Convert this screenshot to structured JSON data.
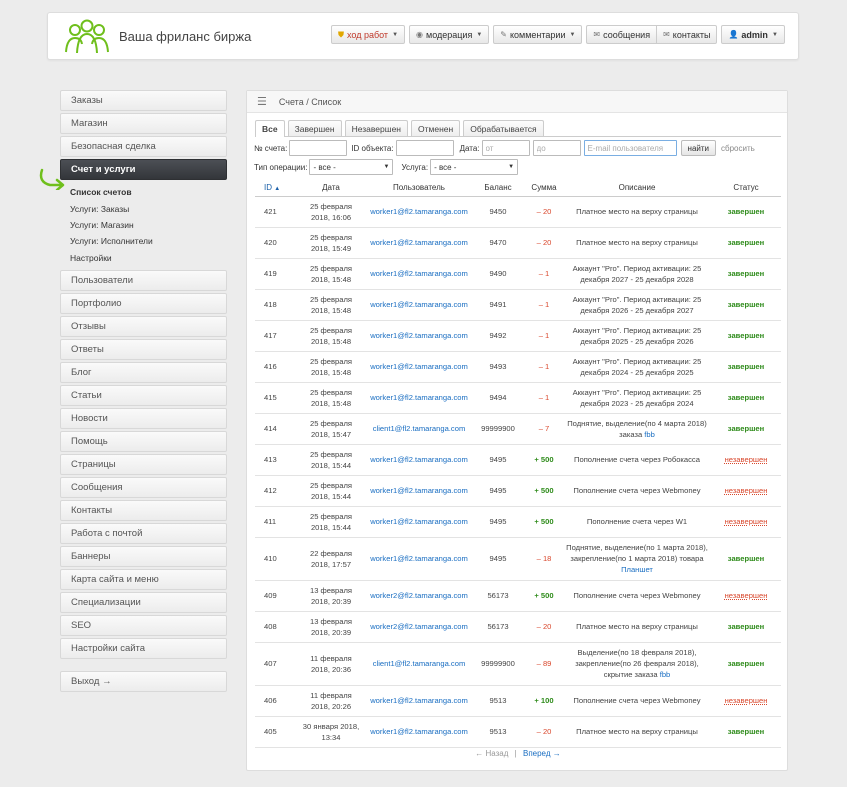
{
  "header": {
    "site_title": "Ваша фриланс биржа",
    "nav": {
      "worker": "ход работ",
      "moderation": "модерация",
      "comments": "комментарии",
      "messages": "сообщения",
      "contacts": "контакты",
      "user": "admin"
    }
  },
  "sidebar": {
    "items_top": [
      {
        "key": "orders",
        "label": "Заказы"
      },
      {
        "key": "shop",
        "label": "Магазин"
      },
      {
        "key": "safe-deal",
        "label": "Безопасная сделка"
      },
      {
        "key": "bills",
        "label": "Счет и услуги"
      }
    ],
    "sub_items": [
      {
        "key": "bills-list",
        "label": "Список счетов"
      },
      {
        "key": "services-orders",
        "label": "Услуги: Заказы"
      },
      {
        "key": "services-shop",
        "label": "Услуги: Магазин"
      },
      {
        "key": "services-performers",
        "label": "Услуги: Исполнители"
      },
      {
        "key": "settings",
        "label": "Настройки"
      }
    ],
    "items_bottom": [
      {
        "key": "users",
        "label": "Пользователи"
      },
      {
        "key": "portfolio",
        "label": "Портфолио"
      },
      {
        "key": "reviews",
        "label": "Отзывы"
      },
      {
        "key": "answers",
        "label": "Ответы"
      },
      {
        "key": "blog",
        "label": "Блог"
      },
      {
        "key": "articles",
        "label": "Статьи"
      },
      {
        "key": "news",
        "label": "Новости"
      },
      {
        "key": "help",
        "label": "Помощь"
      },
      {
        "key": "pages",
        "label": "Страницы"
      },
      {
        "key": "messages",
        "label": "Сообщения"
      },
      {
        "key": "contacts",
        "label": "Контакты"
      },
      {
        "key": "mail",
        "label": "Работа с почтой"
      },
      {
        "key": "banners",
        "label": "Баннеры"
      },
      {
        "key": "sitemap",
        "label": "Карта сайта и меню"
      },
      {
        "key": "specs",
        "label": "Специализации"
      },
      {
        "key": "seo",
        "label": "SEO"
      },
      {
        "key": "site-settings",
        "label": "Настройки сайта"
      }
    ],
    "logout": "Выход →"
  },
  "main": {
    "breadcrumb": "Счета / Список",
    "tabs": [
      "Все",
      "Завершен",
      "Незавершен",
      "Отменен",
      "Обрабатывается"
    ],
    "filters": {
      "bill_no_label": "№ счета:",
      "object_id_label": "ID объекта:",
      "date_label": "Дата:",
      "date_from_placeholder": "от",
      "date_to_placeholder": "до",
      "email_placeholder": "E-mail пользователя",
      "find_label": "найти",
      "reset_label": "сбросить",
      "op_type_label": "Тип операции:",
      "op_type_value": "- все -",
      "service_label": "Услуга:",
      "service_value": "- все -"
    },
    "columns": [
      "ID",
      "Дата",
      "Пользователь",
      "Баланс",
      "Сумма",
      "Описание",
      "Статус"
    ],
    "rows": [
      {
        "id": "421",
        "date1": "25 февраля",
        "date2": "2018, 16:06",
        "user": "worker1@fl2.tamaranga.com",
        "balance": "9450",
        "sum": "– 20",
        "sign": "neg",
        "desc1": "Платное место на верху страницы",
        "desc2": "",
        "desc_link": "",
        "status": "завершен",
        "status_type": "done"
      },
      {
        "id": "420",
        "date1": "25 февраля",
        "date2": "2018, 15:49",
        "user": "worker1@fl2.tamaranga.com",
        "balance": "9470",
        "sum": "– 20",
        "sign": "neg",
        "desc1": "Платное место на верху страницы",
        "desc2": "",
        "desc_link": "",
        "status": "завершен",
        "status_type": "done"
      },
      {
        "id": "419",
        "date1": "25 февраля",
        "date2": "2018, 15:48",
        "user": "worker1@fl2.tamaranga.com",
        "balance": "9490",
        "sum": "– 1",
        "sign": "neg",
        "desc1": "Аккаунт \"Pro\". Период активации: 25",
        "desc2": "декабря 2027 - 25 декабря 2028",
        "desc_link": "",
        "status": "завершен",
        "status_type": "done"
      },
      {
        "id": "418",
        "date1": "25 февраля",
        "date2": "2018, 15:48",
        "user": "worker1@fl2.tamaranga.com",
        "balance": "9491",
        "sum": "– 1",
        "sign": "neg",
        "desc1": "Аккаунт \"Pro\". Период активации: 25",
        "desc2": "декабря 2026 - 25 декабря 2027",
        "desc_link": "",
        "status": "завершен",
        "status_type": "done"
      },
      {
        "id": "417",
        "date1": "25 февраля",
        "date2": "2018, 15:48",
        "user": "worker1@fl2.tamaranga.com",
        "balance": "9492",
        "sum": "– 1",
        "sign": "neg",
        "desc1": "Аккаунт \"Pro\". Период активации: 25",
        "desc2": "декабря 2025 - 25 декабря 2026",
        "desc_link": "",
        "status": "завершен",
        "status_type": "done"
      },
      {
        "id": "416",
        "date1": "25 февраля",
        "date2": "2018, 15:48",
        "user": "worker1@fl2.tamaranga.com",
        "balance": "9493",
        "sum": "– 1",
        "sign": "neg",
        "desc1": "Аккаунт \"Pro\". Период активации: 25",
        "desc2": "декабря 2024 - 25 декабря 2025",
        "desc_link": "",
        "status": "завершен",
        "status_type": "done"
      },
      {
        "id": "415",
        "date1": "25 февраля",
        "date2": "2018, 15:48",
        "user": "worker1@fl2.tamaranga.com",
        "balance": "9494",
        "sum": "– 1",
        "sign": "neg",
        "desc1": "Аккаунт \"Pro\". Период активации: 25",
        "desc2": "декабря 2023 - 25 декабря 2024",
        "desc_link": "",
        "status": "завершен",
        "status_type": "done"
      },
      {
        "id": "414",
        "date1": "25 февраля",
        "date2": "2018, 15:47",
        "user": "client1@fl2.tamaranga.com",
        "balance": "99999900",
        "sum": "– 7",
        "sign": "neg",
        "desc1": "Поднятие, выделение(по 4 марта 2018)",
        "desc2": "заказа",
        "desc_link": "fbb",
        "status": "завершен",
        "status_type": "done"
      },
      {
        "id": "413",
        "date1": "25 февраля",
        "date2": "2018, 15:44",
        "user": "worker1@fl2.tamaranga.com",
        "balance": "9495",
        "sum": "+ 500",
        "sign": "pos",
        "desc1": "Пополнение счета через Робокасса",
        "desc2": "",
        "desc_link": "",
        "status": "незавершен",
        "status_type": "undone"
      },
      {
        "id": "412",
        "date1": "25 февраля",
        "date2": "2018, 15:44",
        "user": "worker1@fl2.tamaranga.com",
        "balance": "9495",
        "sum": "+ 500",
        "sign": "pos",
        "desc1": "Пополнение счета через Webmoney",
        "desc2": "",
        "desc_link": "",
        "status": "незавершен",
        "status_type": "undone"
      },
      {
        "id": "411",
        "date1": "25 февраля",
        "date2": "2018, 15:44",
        "user": "worker1@fl2.tamaranga.com",
        "balance": "9495",
        "sum": "+ 500",
        "sign": "pos",
        "desc1": "Пополнение счета через W1",
        "desc2": "",
        "desc_link": "",
        "status": "незавершен",
        "status_type": "undone"
      },
      {
        "id": "410",
        "date1": "22 февраля",
        "date2": "2018, 17:57",
        "user": "worker1@fl2.tamaranga.com",
        "balance": "9495",
        "sum": "– 18",
        "sign": "neg",
        "desc1": "Поднятие, выделение(по 1 марта 2018),",
        "desc2": "закрепление(по 1 марта 2018) товара",
        "desc_link": "Планшет",
        "status": "завершен",
        "status_type": "done"
      },
      {
        "id": "409",
        "date1": "13 февраля",
        "date2": "2018, 20:39",
        "user": "worker2@fl2.tamaranga.com",
        "balance": "56173",
        "sum": "+ 500",
        "sign": "pos",
        "desc1": "Пополнение счета через Webmoney",
        "desc2": "",
        "desc_link": "",
        "status": "незавершен",
        "status_type": "undone"
      },
      {
        "id": "408",
        "date1": "13 февраля",
        "date2": "2018, 20:39",
        "user": "worker2@fl2.tamaranga.com",
        "balance": "56173",
        "sum": "– 20",
        "sign": "neg",
        "desc1": "Платное место на верху страницы",
        "desc2": "",
        "desc_link": "",
        "status": "завершен",
        "status_type": "done"
      },
      {
        "id": "407",
        "date1": "11 февраля",
        "date2": "2018, 20:36",
        "user": "client1@fl2.tamaranga.com",
        "balance": "99999900",
        "sum": "– 89",
        "sign": "neg",
        "desc1": "Выделение(по 18 февраля 2018),",
        "desc2": "закрепление(по 26 февраля 2018),",
        "desc3": "скрытие заказа",
        "desc_link": "fbb",
        "status": "завершен",
        "status_type": "done"
      },
      {
        "id": "406",
        "date1": "11 февраля",
        "date2": "2018, 20:26",
        "user": "worker1@fl2.tamaranga.com",
        "balance": "9513",
        "sum": "+ 100",
        "sign": "pos",
        "desc1": "Пополнение счета через Webmoney",
        "desc2": "",
        "desc_link": "",
        "status": "незавершен",
        "status_type": "undone"
      },
      {
        "id": "405",
        "date1": "30 января 2018,",
        "date2": "13:34",
        "user": "worker1@fl2.tamaranga.com",
        "balance": "9513",
        "sum": "– 20",
        "sign": "neg",
        "desc1": "Платное место на верху страницы",
        "desc2": "",
        "desc_link": "",
        "status": "завершен",
        "status_type": "done"
      }
    ],
    "pager": {
      "prev": "← Назад",
      "sep": "|",
      "next": "Вперед →"
    }
  },
  "colors": {
    "active_sidebar": "#3b3e43",
    "arrow": "#6fbf1c",
    "link": "#1a6ec2",
    "negative": "#d9472c",
    "positive": "#2e8b1a"
  }
}
